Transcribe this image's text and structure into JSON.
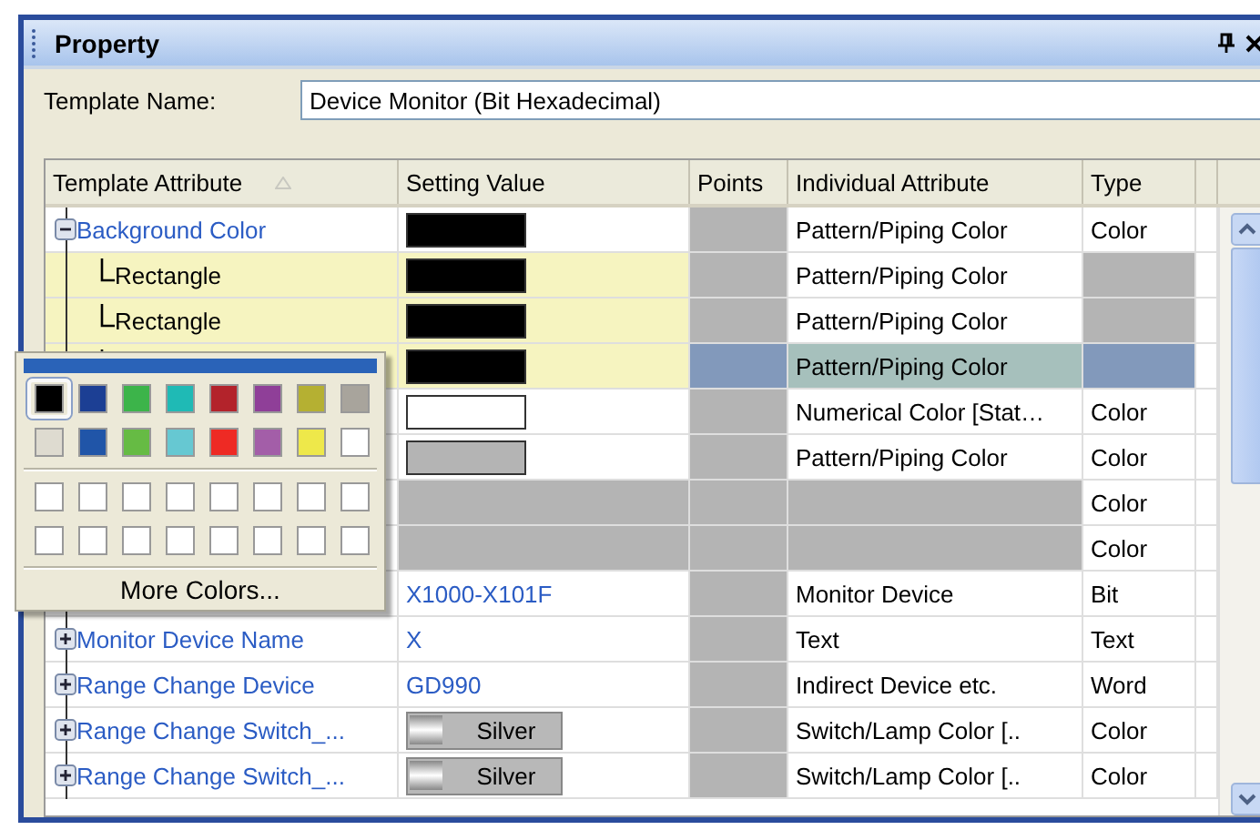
{
  "panel": {
    "title": "Property"
  },
  "template_name": {
    "label": "Template Name:",
    "value": "Device Monitor (Bit Hexadecimal)"
  },
  "grid": {
    "columns": [
      "Template Attribute",
      "Setting Value",
      "Points",
      "Individual Attribute",
      "Type"
    ],
    "rows": [
      {
        "attribute": "Background Color",
        "expanded": true,
        "selected": false,
        "value": {
          "kind": "swatch",
          "color": "#000000"
        },
        "individual": "Pattern/Piping Color",
        "type": "Color",
        "children": [
          {
            "attribute": "Rectangle",
            "selected": false,
            "value": {
              "kind": "swatch",
              "color": "#000000"
            },
            "individual": "Pattern/Piping Color"
          },
          {
            "attribute": "Rectangle",
            "selected": false,
            "value": {
              "kind": "swatch",
              "color": "#000000"
            },
            "individual": "Pattern/Piping Color"
          },
          {
            "selected": true,
            "value": {
              "kind": "swatch",
              "color": "#000000"
            },
            "individual": "Pattern/Piping Color"
          }
        ]
      },
      {
        "selected": false,
        "value": {
          "kind": "swatch",
          "color": "#ffffff"
        },
        "individual": "Numerical Color [Stat…",
        "type": "Color"
      },
      {
        "selected": false,
        "value": {
          "kind": "swatch",
          "color": "#b4b4b4"
        },
        "individual": "Pattern/Piping Color",
        "type": "Color"
      },
      {
        "selected": false,
        "value": {
          "kind": "blank"
        },
        "type": "Color"
      },
      {
        "selected": false,
        "value": {
          "kind": "blank"
        },
        "type": "Color"
      },
      {
        "selected": false,
        "value": {
          "kind": "text",
          "text": "X1000-X101F"
        },
        "individual": "Monitor Device",
        "type": "Bit"
      },
      {
        "attribute": "Monitor Device Name",
        "expanded": false,
        "selected": false,
        "value": {
          "kind": "text",
          "text": "X"
        },
        "individual": "Text",
        "type": "Text"
      },
      {
        "attribute": "Range Change Device",
        "expanded": false,
        "selected": false,
        "value": {
          "kind": "text",
          "text": "GD990"
        },
        "individual": "Indirect Device etc.",
        "type": "Word"
      },
      {
        "attribute": "Range Change Switch_...",
        "expanded": false,
        "selected": false,
        "value": {
          "kind": "button",
          "text": "Silver"
        },
        "individual": "Switch/Lamp Color [..",
        "type": "Color"
      },
      {
        "attribute": "Range Change Switch_...",
        "expanded": false,
        "selected": false,
        "value": {
          "kind": "button",
          "text": "Silver"
        },
        "individual": "Switch/Lamp Color [..",
        "type": "Color"
      }
    ]
  },
  "color_popup": {
    "standard_colors": [
      {
        "color": "#000000",
        "selected": true
      },
      {
        "color": "#1c3f94",
        "selected": false
      },
      {
        "color": "#3cb44a",
        "selected": false
      },
      {
        "color": "#1fbab5",
        "selected": false
      },
      {
        "color": "#b3232b",
        "selected": false
      },
      {
        "color": "#8f3f98",
        "selected": false
      },
      {
        "color": "#b5b032",
        "selected": false
      },
      {
        "color": "#a8a49c",
        "selected": false
      },
      {
        "color": "#dedbd0",
        "selected": false
      },
      {
        "color": "#2055a8",
        "selected": false
      },
      {
        "color": "#66bb44",
        "selected": false
      },
      {
        "color": "#66c8d2",
        "selected": false
      },
      {
        "color": "#ee2a24",
        "selected": false
      },
      {
        "color": "#a35ea8",
        "selected": false
      },
      {
        "color": "#eee84a",
        "selected": false
      },
      {
        "color": "#ffffff",
        "selected": false
      }
    ],
    "custom_colors": [
      {
        "color": "#ffffff"
      },
      {
        "color": "#ffffff"
      },
      {
        "color": "#ffffff"
      },
      {
        "color": "#ffffff"
      },
      {
        "color": "#ffffff"
      },
      {
        "color": "#ffffff"
      },
      {
        "color": "#ffffff"
      },
      {
        "color": "#ffffff"
      },
      {
        "color": "#ffffff"
      },
      {
        "color": "#ffffff"
      },
      {
        "color": "#ffffff"
      },
      {
        "color": "#ffffff"
      },
      {
        "color": "#ffffff"
      },
      {
        "color": "#ffffff"
      },
      {
        "color": "#ffffff"
      },
      {
        "color": "#ffffff"
      }
    ],
    "more_label": "More Colors..."
  }
}
